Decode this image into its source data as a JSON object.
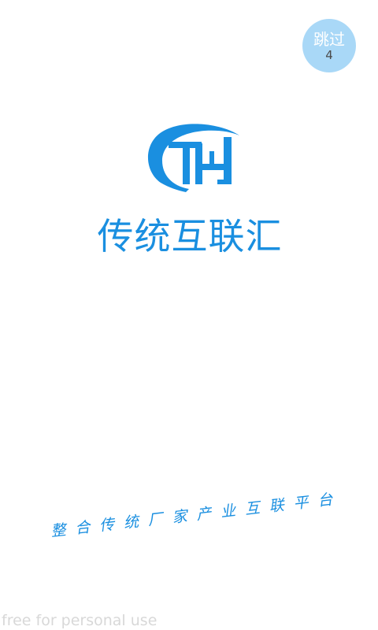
{
  "skip": {
    "label": "跳过",
    "countdown": "4"
  },
  "logo": {
    "name": "CHJ logo",
    "color": "#1a8fe0"
  },
  "brand": {
    "name": "传统互联汇"
  },
  "tagline": "整合传统厂家产业互联平台",
  "watermark": "free for personal use",
  "colors": {
    "brand_blue": "#1a8fe0",
    "skip_background": "#a9d8f7",
    "background": "#ffffff"
  }
}
